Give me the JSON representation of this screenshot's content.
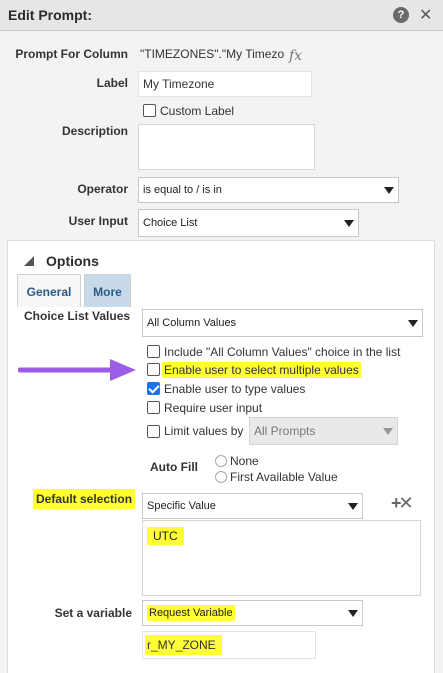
{
  "dialog": {
    "title": "Edit Prompt:",
    "help_glyph": "?",
    "close_glyph": "✕"
  },
  "form": {
    "prompt_for_column_label": "Prompt For Column",
    "prompt_for_column_value": "\"TIMEZONES\".\"My Timezo",
    "fx_glyph": "fx",
    "label_label": "Label",
    "label_value": "My Timezone",
    "custom_label": "Custom Label",
    "description_label": "Description",
    "description_value": "",
    "operator_label": "Operator",
    "operator_value": "is equal to / is in",
    "user_input_label": "User Input",
    "user_input_value": "Choice List"
  },
  "options": {
    "header": "Options",
    "tabs": [
      {
        "label": "General"
      },
      {
        "label": "More"
      }
    ],
    "choice_list_values_label": "Choice List Values",
    "choice_list_values_value": "All Column Values",
    "checkboxes": [
      {
        "label": "Include \"All Column Values\" choice in the list",
        "checked": false
      },
      {
        "label": "Enable user to select multiple values",
        "checked": false
      },
      {
        "label": "Enable user to type values",
        "checked": true
      },
      {
        "label": "Require user input",
        "checked": false
      },
      {
        "label": "Limit values by",
        "checked": false
      }
    ],
    "limit_values_by_value": "All Prompts",
    "auto_fill_label": "Auto Fill",
    "auto_fill_options": [
      {
        "label": "None"
      },
      {
        "label": "First Available Value"
      }
    ],
    "default_selection_label": "Default selection",
    "default_selection_value": "Specific Value",
    "default_values_text": "UTC",
    "add_remove_glyph": "+✕",
    "set_variable_label": "Set a variable",
    "set_variable_value": "Request Variable",
    "variable_name_value": "r_MY_ZONE"
  },
  "colors": {
    "highlight": "#ffff33",
    "arrow": "#9b5de5",
    "checkbox": "#1a73e8",
    "tab_text": "#2a5a86"
  }
}
